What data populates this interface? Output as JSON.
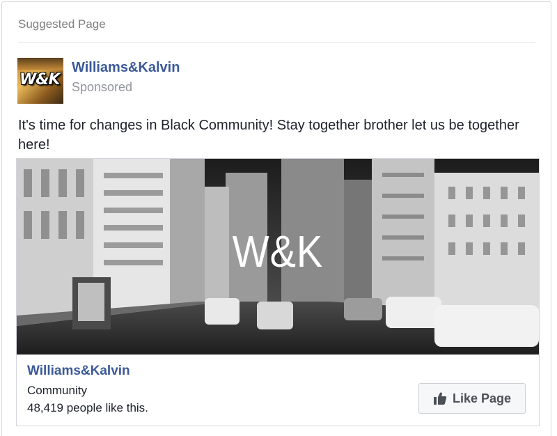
{
  "post": {
    "header_label": "Suggested Page",
    "page_name": "Williams&Kalvin",
    "sponsored_label": "Sponsored",
    "avatar_text": "W&K",
    "text": "It's time for changes in Black Community! Stay together brother let us be together here!"
  },
  "attachment": {
    "image_logo": "W&K",
    "title": "Williams&Kalvin",
    "category": "Community",
    "likes": "48,419 people like this.",
    "like_button_label": "Like Page",
    "like_icon": "thumbs-up-icon"
  },
  "colors": {
    "link_blue": "#3b5998",
    "muted_gray": "#90949c",
    "button_bg": "#f6f7f9"
  }
}
